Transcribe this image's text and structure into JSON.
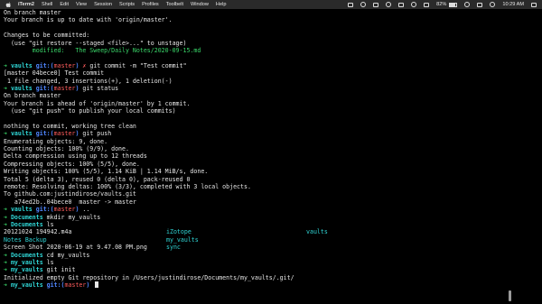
{
  "menubar": {
    "app_name": "iTerm2",
    "menus": [
      "Shell",
      "Edit",
      "View",
      "Session",
      "Scripts",
      "Profiles",
      "Toolbelt",
      "Window",
      "Help"
    ],
    "battery_percent": "82%",
    "time": "10:29 AM"
  },
  "terminal": {
    "l01": "On branch master",
    "l02": "Your branch is up to date with 'origin/master'.",
    "l03": "",
    "l04": "Changes to be committed:",
    "l05": "  (use \"git restore --staged <file>...\" to unstage)",
    "l06_label": "        modified:   ",
    "l06_file": "The Sweep/Daily Notes/2020-09-15.md",
    "l07": "",
    "p1": {
      "cwd": "vaults",
      "git": "git:(",
      "branch": "master",
      "close": ")",
      "extra": " ✗",
      "cmd": " git commit -m \"Test commit\""
    },
    "l09": "[master 04bece0] Test commit",
    "l10": " 1 file changed, 3 insertions(+), 1 deletion(-)",
    "p2": {
      "cwd": "vaults",
      "git": "git:(",
      "branch": "master",
      "close": ")",
      "cmd": " git status"
    },
    "l12": "On branch master",
    "l13": "Your branch is ahead of 'origin/master' by 1 commit.",
    "l14": "  (use \"git push\" to publish your local commits)",
    "l15": "",
    "l16": "nothing to commit, working tree clean",
    "p3": {
      "cwd": "vaults",
      "git": "git:(",
      "branch": "master",
      "close": ")",
      "cmd": " git push"
    },
    "l18": "Enumerating objects: 9, done.",
    "l19": "Counting objects: 100% (9/9), done.",
    "l20": "Delta compression using up to 12 threads",
    "l21": "Compressing objects: 100% (5/5), done.",
    "l22": "Writing objects: 100% (5/5), 1.14 KiB | 1.14 MiB/s, done.",
    "l23": "Total 5 (delta 3), reused 0 (delta 0), pack-reused 0",
    "l24": "remote: Resolving deltas: 100% (3/3), completed with 3 local objects.",
    "l25": "To github.com:justindirose/vaults.git",
    "l26": "   a74ed2b..04bece0  master -> master",
    "p4": {
      "cwd": "vaults",
      "git": "git:(",
      "branch": "master",
      "close": ")",
      "cmd": " .."
    },
    "p5": {
      "cwd": "Documents",
      "cmd": " mkdir my_vaults"
    },
    "p6": {
      "cwd": "Documents",
      "cmd": " ls"
    },
    "ls_row1": [
      "20121024 194942.m4a",
      "iZotope",
      "vaults"
    ],
    "ls_row2": [
      "Notes Backup",
      "my_vaults",
      ""
    ],
    "ls_row3": [
      "Screen Shot 2020-06-19 at 9.47.08 PM.png",
      "sync",
      ""
    ],
    "p7": {
      "cwd": "Documents",
      "cmd": " cd my_vaults"
    },
    "p8": {
      "cwd": "my_vaults",
      "cmd": " ls"
    },
    "p9": {
      "cwd": "my_vaults",
      "cmd": " git init"
    },
    "l37": "Initialized empty Git repository in /Users/justindirose/Documents/my_vaults/.git/",
    "p10": {
      "cwd": "my_vaults",
      "git": "git:(",
      "branch": "master",
      "close": ")",
      "cmd": " "
    }
  },
  "colors": {
    "prompt_arrow": "#3ad86a",
    "cwd": "#2fd4d4",
    "git_label": "#4f86ff",
    "branch": "#ff5c5c",
    "modified": "#3ad86a"
  }
}
